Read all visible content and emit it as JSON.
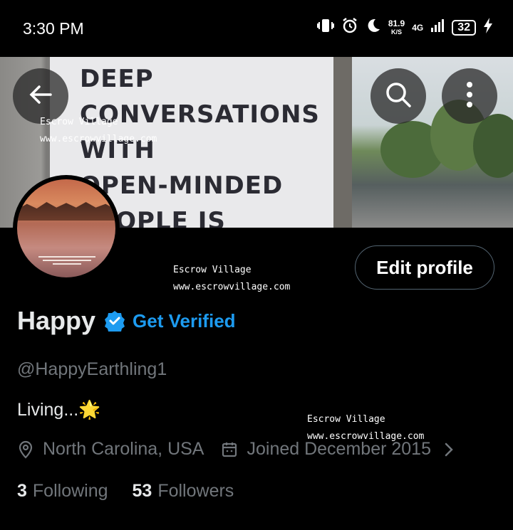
{
  "status_bar": {
    "time": "3:30 PM",
    "speed_value": "81.9",
    "speed_unit": "K/S",
    "network": "4G",
    "battery": "32"
  },
  "banner": {
    "sign_text": "DEEP\nCONVERSATIONS\nWITH\nOPEN-MINDED\nPEOPLE IS"
  },
  "watermarks": [
    {
      "name": "Escrow Village",
      "url": "www.escrowvillage.com"
    },
    {
      "name": "Escrow Village",
      "url": "www.escrowvillage.com"
    },
    {
      "name": "Escrow Village",
      "url": "www.escrowvillage.com"
    }
  ],
  "profile": {
    "edit_button": "Edit profile",
    "name": "Happy",
    "get_verified": "Get Verified",
    "handle": "@HappyEarthling1",
    "bio": "Living...🌟",
    "location": "North Carolina, USA",
    "joined": "Joined December 2015",
    "following_count": "3",
    "following_label": "Following",
    "followers_count": "53",
    "followers_label": "Followers"
  },
  "colors": {
    "accent": "#1d9bf0",
    "secondary_text": "#71767b",
    "background": "#000000"
  },
  "icons": [
    "back-arrow-icon",
    "search-icon",
    "more-vertical-icon",
    "verified-badge-icon",
    "location-pin-icon",
    "calendar-icon",
    "chevron-right-icon"
  ]
}
